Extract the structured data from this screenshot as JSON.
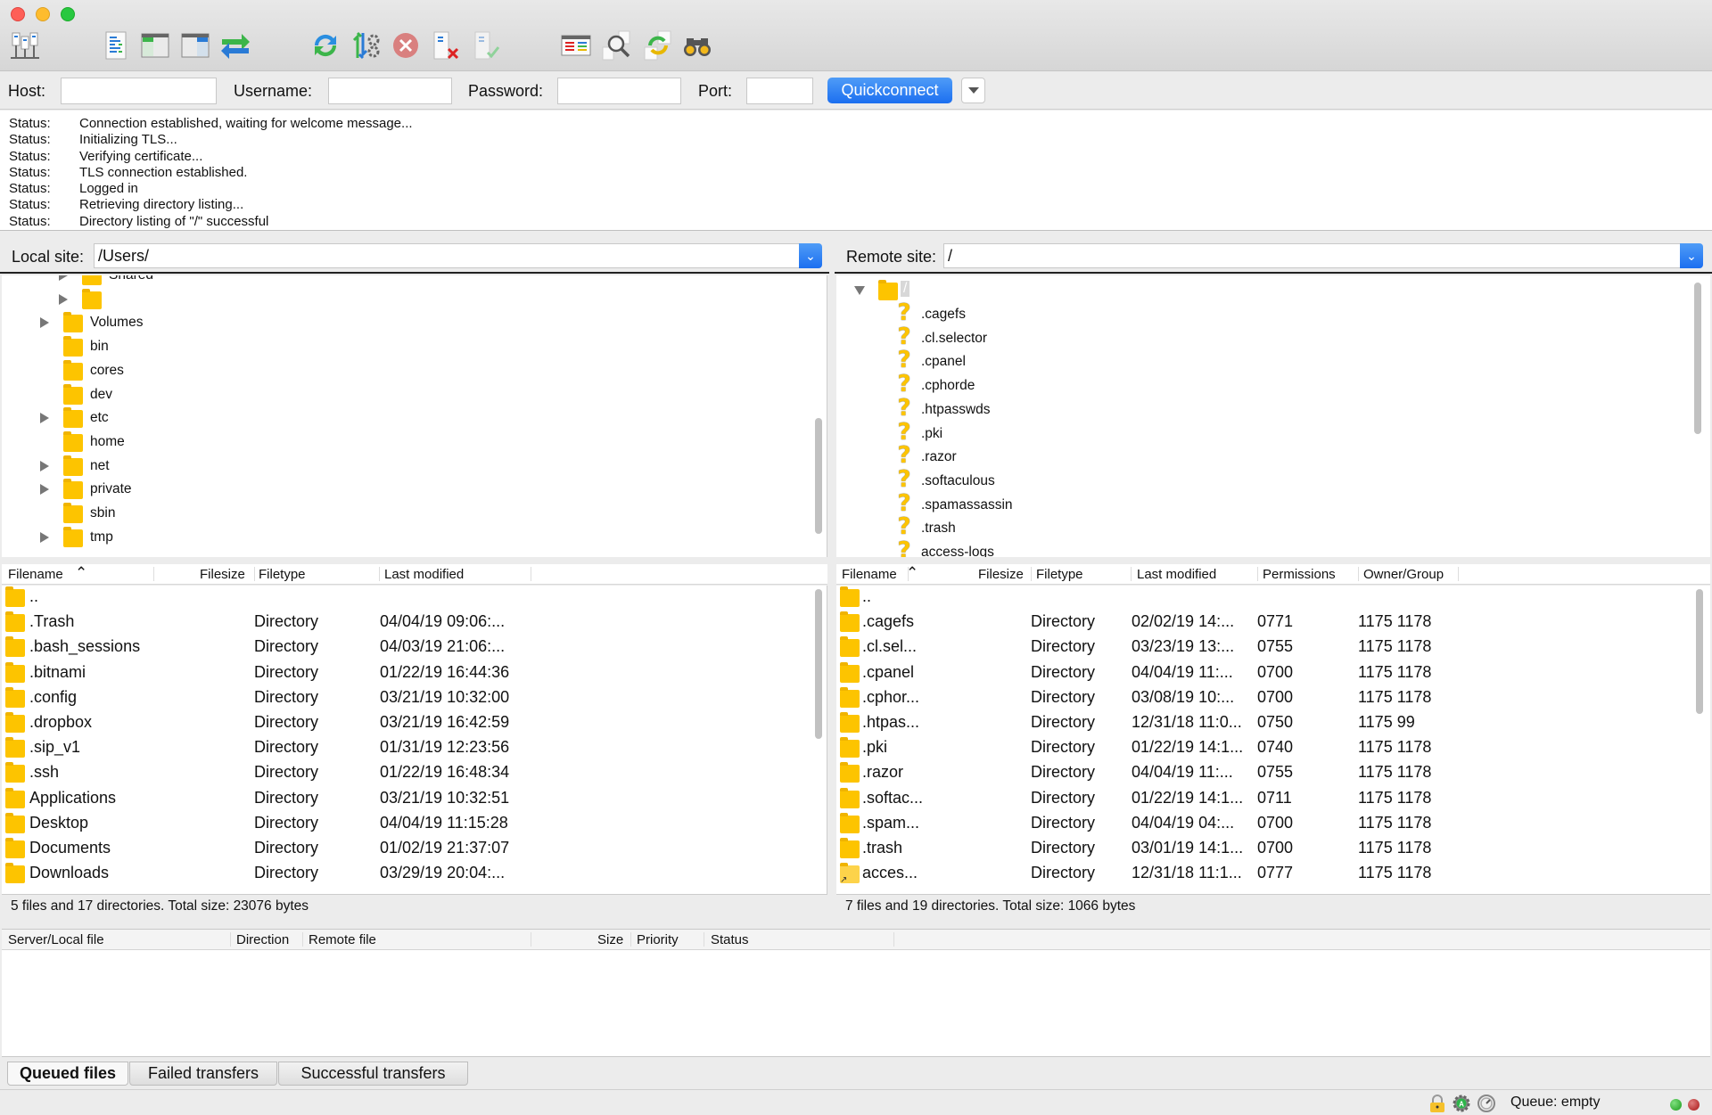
{
  "window": {
    "traffic_lights": [
      "close",
      "minimize",
      "maximize"
    ]
  },
  "toolbar": {
    "buttons": [
      {
        "name": "site-manager-icon",
        "label": "Site Manager"
      },
      {
        "name": "message-log-icon",
        "label": "Toggle message log"
      },
      {
        "name": "local-tree-icon",
        "label": "Toggle local directory tree"
      },
      {
        "name": "remote-tree-icon",
        "label": "Toggle remote directory tree"
      },
      {
        "name": "transfer-queue-icon",
        "label": "Toggle transfer queue"
      },
      {
        "name": "refresh-icon",
        "label": "Refresh"
      },
      {
        "name": "process-queue-icon",
        "label": "Process queue"
      },
      {
        "name": "cancel-icon",
        "label": "Cancel current operation"
      },
      {
        "name": "disconnect-icon",
        "label": "Disconnect"
      },
      {
        "name": "reconnect-icon",
        "label": "Reconnect"
      },
      {
        "name": "directory-comparison-icon",
        "label": "Directory comparison"
      },
      {
        "name": "filter-icon",
        "label": "Filename filters"
      },
      {
        "name": "sync-browsing-icon",
        "label": "Synchronized browsing"
      },
      {
        "name": "search-icon",
        "label": "Search remote files"
      }
    ]
  },
  "quickconnect": {
    "host_label": "Host:",
    "host_value": "",
    "username_label": "Username:",
    "username_value": "",
    "password_label": "Password:",
    "password_value": "",
    "port_label": "Port:",
    "port_value": "",
    "button_label": "Quickconnect"
  },
  "message_log": [
    {
      "key": "Status:",
      "text": "Connection established, waiting for welcome message..."
    },
    {
      "key": "Status:",
      "text": "Initializing TLS..."
    },
    {
      "key": "Status:",
      "text": "Verifying certificate..."
    },
    {
      "key": "Status:",
      "text": "TLS connection established."
    },
    {
      "key": "Status:",
      "text": "Logged in"
    },
    {
      "key": "Status:",
      "text": "Retrieving directory listing..."
    },
    {
      "key": "Status:",
      "text": "Directory listing of \"/\" successful"
    }
  ],
  "local": {
    "site_label": "Local site:",
    "site_path": "/Users/",
    "tree": [
      {
        "label": "Shared",
        "indent": 2,
        "expandable": true
      },
      {
        "label": "",
        "indent": 2,
        "expandable": true
      },
      {
        "label": "Volumes",
        "indent": 1,
        "expandable": true
      },
      {
        "label": "bin",
        "indent": 1,
        "expandable": false
      },
      {
        "label": "cores",
        "indent": 1,
        "expandable": false
      },
      {
        "label": "dev",
        "indent": 1,
        "expandable": false
      },
      {
        "label": "etc",
        "indent": 1,
        "expandable": true
      },
      {
        "label": "home",
        "indent": 1,
        "expandable": false
      },
      {
        "label": "net",
        "indent": 1,
        "expandable": true
      },
      {
        "label": "private",
        "indent": 1,
        "expandable": true
      },
      {
        "label": "sbin",
        "indent": 1,
        "expandable": false
      },
      {
        "label": "tmp",
        "indent": 1,
        "expandable": true
      }
    ],
    "columns": [
      "Filename",
      "Filesize",
      "Filetype",
      "Last modified"
    ],
    "files": [
      {
        "name": "..",
        "size": "",
        "type": "",
        "modified": ""
      },
      {
        "name": ".Trash",
        "size": "",
        "type": "Directory",
        "modified": "04/04/19 09:06:..."
      },
      {
        "name": ".bash_sessions",
        "size": "",
        "type": "Directory",
        "modified": "04/03/19 21:06:..."
      },
      {
        "name": ".bitnami",
        "size": "",
        "type": "Directory",
        "modified": "01/22/19 16:44:36"
      },
      {
        "name": ".config",
        "size": "",
        "type": "Directory",
        "modified": "03/21/19 10:32:00"
      },
      {
        "name": ".dropbox",
        "size": "",
        "type": "Directory",
        "modified": "03/21/19 16:42:59"
      },
      {
        "name": ".sip_v1",
        "size": "",
        "type": "Directory",
        "modified": "01/31/19 12:23:56"
      },
      {
        "name": ".ssh",
        "size": "",
        "type": "Directory",
        "modified": "01/22/19 16:48:34"
      },
      {
        "name": "Applications",
        "size": "",
        "type": "Directory",
        "modified": "03/21/19 10:32:51"
      },
      {
        "name": "Desktop",
        "size": "",
        "type": "Directory",
        "modified": "04/04/19 11:15:28"
      },
      {
        "name": "Documents",
        "size": "",
        "type": "Directory",
        "modified": "01/02/19 21:37:07"
      },
      {
        "name": "Downloads",
        "size": "",
        "type": "Directory",
        "modified": "03/29/19 20:04:..."
      }
    ],
    "summary": "5 files and 17 directories. Total size: 23076 bytes"
  },
  "remote": {
    "site_label": "Remote site:",
    "site_path": "/",
    "tree_root": "/",
    "tree": [
      ".cagefs",
      ".cl.selector",
      ".cpanel",
      ".cphorde",
      ".htpasswds",
      ".pki",
      ".razor",
      ".softaculous",
      ".spamassassin",
      ".trash",
      "access-logs"
    ],
    "columns": [
      "Filename",
      "Filesize",
      "Filetype",
      "Last modified",
      "Permissions",
      "Owner/Group"
    ],
    "files": [
      {
        "name": "..",
        "size": "",
        "type": "",
        "modified": "",
        "perms": "",
        "owner": "",
        "link": false
      },
      {
        "name": ".cagefs",
        "size": "",
        "type": "Directory",
        "modified": "02/02/19 14:...",
        "perms": "0771",
        "owner": "1175 1178",
        "link": false
      },
      {
        "name": ".cl.sel...",
        "size": "",
        "type": "Directory",
        "modified": "03/23/19 13:...",
        "perms": "0755",
        "owner": "1175 1178",
        "link": false
      },
      {
        "name": ".cpanel",
        "size": "",
        "type": "Directory",
        "modified": "04/04/19 11:...",
        "perms": "0700",
        "owner": "1175 1178",
        "link": false
      },
      {
        "name": ".cphor...",
        "size": "",
        "type": "Directory",
        "modified": "03/08/19 10:...",
        "perms": "0700",
        "owner": "1175 1178",
        "link": false
      },
      {
        "name": ".htpas...",
        "size": "",
        "type": "Directory",
        "modified": "12/31/18 11:0...",
        "perms": "0750",
        "owner": "1175 99",
        "link": false
      },
      {
        "name": ".pki",
        "size": "",
        "type": "Directory",
        "modified": "01/22/19 14:1...",
        "perms": "0740",
        "owner": "1175 1178",
        "link": false
      },
      {
        "name": ".razor",
        "size": "",
        "type": "Directory",
        "modified": "04/04/19 11:...",
        "perms": "0755",
        "owner": "1175 1178",
        "link": false
      },
      {
        "name": ".softac...",
        "size": "",
        "type": "Directory",
        "modified": "01/22/19 14:1...",
        "perms": "0711",
        "owner": "1175 1178",
        "link": false
      },
      {
        "name": ".spam...",
        "size": "",
        "type": "Directory",
        "modified": "04/04/19 04:...",
        "perms": "0700",
        "owner": "1175 1178",
        "link": false
      },
      {
        "name": ".trash",
        "size": "",
        "type": "Directory",
        "modified": "03/01/19 14:1...",
        "perms": "0700",
        "owner": "1175 1178",
        "link": false
      },
      {
        "name": "acces...",
        "size": "",
        "type": "Directory",
        "modified": "12/31/18 11:1...",
        "perms": "0777",
        "owner": "1175 1178",
        "link": true
      }
    ],
    "summary": "7 files and 19 directories. Total size: 1066 bytes"
  },
  "queue": {
    "columns": [
      "Server/Local file",
      "Direction",
      "Remote file",
      "Size",
      "Priority",
      "Status"
    ],
    "tabs": [
      {
        "label": "Queued files",
        "active": true
      },
      {
        "label": "Failed transfers",
        "active": false
      },
      {
        "label": "Successful transfers",
        "active": false
      }
    ]
  },
  "statusbar": {
    "queue_text": "Queue: empty",
    "icons": [
      "lock-icon",
      "auto-mode-icon",
      "speed-limit-icon"
    ],
    "leds": {
      "upload": "#1a9a1a",
      "download": "#a81313"
    }
  },
  "colors": {
    "accent": "#1c6ff0",
    "folder": "#fdc400"
  }
}
